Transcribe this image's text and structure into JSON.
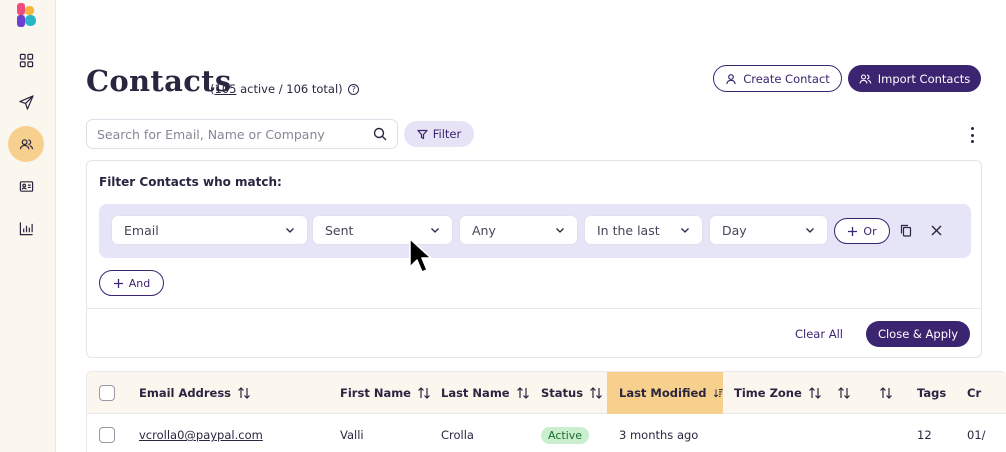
{
  "sidebar": {
    "items": [
      {
        "icon": "grid-icon",
        "active": false
      },
      {
        "icon": "paper-plane-icon",
        "active": false
      },
      {
        "icon": "contacts-icon",
        "active": true
      },
      {
        "icon": "id-card-icon",
        "active": false
      },
      {
        "icon": "bar-chart-icon",
        "active": false
      }
    ]
  },
  "header": {
    "title": "Contacts",
    "count_open": "(",
    "active_count": "105",
    "count_rest": " active / 106 total)",
    "help_glyph": "?",
    "create_label": "Create Contact",
    "import_label": "Import Contacts"
  },
  "search": {
    "placeholder": "Search for Email, Name or Company",
    "value": ""
  },
  "filter_button": {
    "label": "Filter"
  },
  "filter_panel": {
    "heading": "Filter Contacts who match:",
    "rule": {
      "field": "Email",
      "event": "Sent",
      "qualifier": "Any",
      "window": "In the last",
      "unit": "Day"
    },
    "or_label": "Or",
    "and_label": "And",
    "clear_label": "Clear All",
    "apply_label": "Close & Apply"
  },
  "table": {
    "columns": [
      "Email Address",
      "First Name",
      "Last Name",
      "Status",
      "Last Modified",
      "Time Zone",
      "",
      "",
      "Tags",
      "Cr"
    ],
    "sorted_column": "Last Modified",
    "rows": [
      {
        "email": "vcrolla0@paypal.com",
        "first_name": "Valli",
        "last_name": "Crolla",
        "status": "Active",
        "last_modified": "3 months ago",
        "time_zone": "",
        "tags": "12",
        "created": "01/"
      }
    ]
  },
  "colors": {
    "brand": "#3b2470",
    "sidebar_bg": "#fbf6ee",
    "active_nav": "#f6d08c",
    "filter_bg": "#e6e5f8",
    "status_active_bg": "#c9efcf"
  }
}
